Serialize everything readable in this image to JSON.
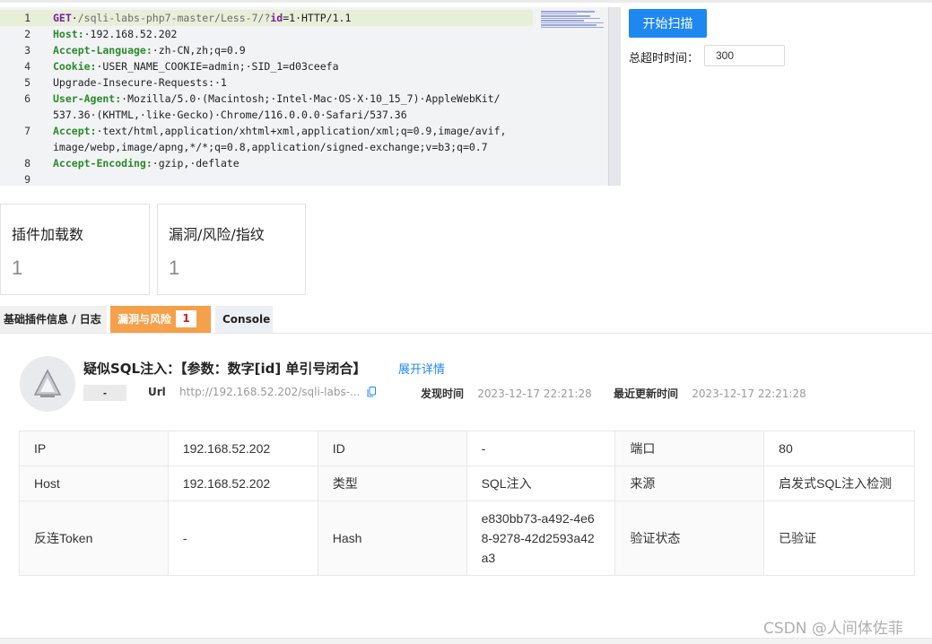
{
  "editor": {
    "lines": [
      {
        "n": "1",
        "segs": [
          [
            "kw",
            "GET"
          ],
          [
            "plain",
            "·"
          ],
          [
            "pathv",
            "/sqli-labs-php7-master/Less-7/?"
          ],
          [
            "kw",
            "id"
          ],
          [
            "plain",
            "=1·HTTP/1.1"
          ]
        ]
      },
      {
        "n": "2",
        "segs": [
          [
            "key",
            "Host:"
          ],
          [
            "plain",
            "·192.168.52.202"
          ]
        ]
      },
      {
        "n": "3",
        "segs": [
          [
            "key",
            "Accept-Language:"
          ],
          [
            "plain",
            "·zh-CN,zh;q=0.9"
          ]
        ]
      },
      {
        "n": "4",
        "segs": [
          [
            "key",
            "Cookie:"
          ],
          [
            "plain",
            "·USER_NAME_COOKIE=admin;·SID_1=d03ceefa"
          ]
        ]
      },
      {
        "n": "5",
        "segs": [
          [
            "plain",
            "Upgrade-Insecure-Requests:·1"
          ]
        ]
      },
      {
        "n": "6",
        "segs": [
          [
            "key",
            "User-Agent:"
          ],
          [
            "plain",
            "·Mozilla/5.0·(Macintosh;·Intel·Mac·OS·X·10_15_7)·AppleWebKit/"
          ]
        ]
      },
      {
        "n": "",
        "segs": [
          [
            "plain",
            "537.36·(KHTML,·like·Gecko)·Chrome/116.0.0.0·Safari/537.36"
          ]
        ]
      },
      {
        "n": "7",
        "segs": [
          [
            "key",
            "Accept:"
          ],
          [
            "plain",
            "·text/html,application/xhtml+xml,application/xml;q=0.9,image/avif,"
          ]
        ]
      },
      {
        "n": "",
        "segs": [
          [
            "plain",
            "image/webp,image/apng,*/*;q=0.8,application/signed-exchange;v=b3;q=0.7"
          ]
        ]
      },
      {
        "n": "8",
        "segs": [
          [
            "key",
            "Accept-Encoding:"
          ],
          [
            "plain",
            "·gzip,·deflate"
          ]
        ]
      },
      {
        "n": "9",
        "segs": []
      }
    ]
  },
  "controls": {
    "scan_button": "开始扫描",
    "timeout_label": "总超时时间：",
    "timeout_value": "300"
  },
  "stats": {
    "plugins_label": "插件加载数",
    "plugins_value": "1",
    "vulns_label": "漏洞/风险/指纹",
    "vulns_value": "1"
  },
  "tabs": {
    "basic": "基础插件信息 / 日志",
    "vuln": "漏洞与风险",
    "vuln_badge": "1",
    "console": "Console"
  },
  "vuln": {
    "title": "疑似SQL注入：【参数：数字[id] 单引号闭合】",
    "expand": "展开详情",
    "level": "-",
    "url_label": "Url",
    "url_value": "http://192.168.52.202/sqli-labs-...",
    "found_label": "发现时间",
    "found_value": "2023-12-17 22:21:28",
    "updated_label": "最近更新时间",
    "updated_value": "2023-12-17 22:21:28"
  },
  "details": {
    "ip_k": "IP",
    "ip_v": "192.168.52.202",
    "id_k": "ID",
    "id_v": "-",
    "port_k": "端口",
    "port_v": "80",
    "host_k": "Host",
    "host_v": "192.168.52.202",
    "type_k": "类型",
    "type_v": "SQL注入",
    "source_k": "来源",
    "source_v": "启发式SQL注入检测",
    "token_k": "反连Token",
    "token_v": "-",
    "hash_k": "Hash",
    "hash_v": "e830bb73-a492-4e68-9278-42d2593a42a3",
    "verify_k": "验证状态",
    "verify_v": "已验证",
    "verify_color": "#2ea44f"
  },
  "watermark": "CSDN @人间体佐菲"
}
